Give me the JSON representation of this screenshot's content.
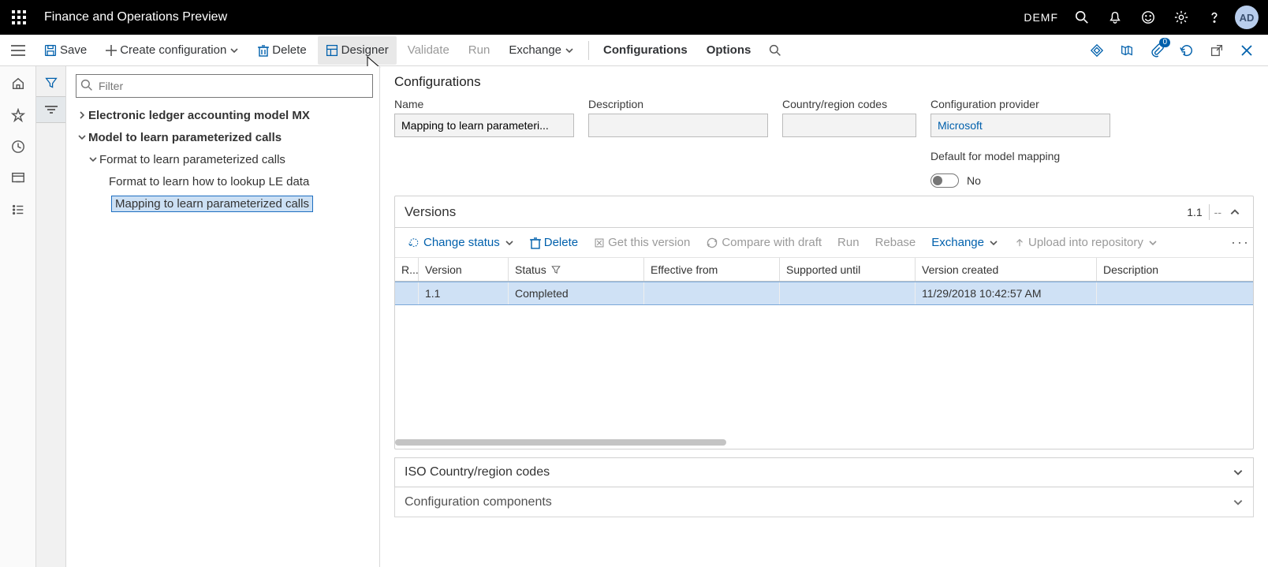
{
  "titlebar": {
    "app_title": "Finance and Operations Preview",
    "company": "DEMF",
    "avatar": "AD"
  },
  "actionbar": {
    "save": "Save",
    "create": "Create configuration",
    "delete": "Delete",
    "designer": "Designer",
    "validate": "Validate",
    "run": "Run",
    "exchange": "Exchange",
    "configurations": "Configurations",
    "options": "Options",
    "attach_count": "0"
  },
  "tree": {
    "filter_placeholder": "Filter",
    "items": {
      "root": "Electronic ledger accounting model MX",
      "model": "Model to learn parameterized calls",
      "format": "Format to learn parameterized calls",
      "format_le": "Format to learn how to lookup LE data",
      "mapping": "Mapping to learn parameterized calls"
    }
  },
  "details": {
    "section": "Configurations",
    "labels": {
      "name": "Name",
      "description": "Description",
      "country": "Country/region codes",
      "provider": "Configuration provider",
      "default_mapping": "Default for model mapping"
    },
    "values": {
      "name": "Mapping to learn parameteri...",
      "description": "",
      "country": "",
      "provider": "Microsoft",
      "default_mapping": "No"
    }
  },
  "versions": {
    "title": "Versions",
    "current": "1.1",
    "dash": "--",
    "toolbar": {
      "change_status": "Change status",
      "delete": "Delete",
      "get_version": "Get this version",
      "compare": "Compare with draft",
      "run": "Run",
      "rebase": "Rebase",
      "exchange": "Exchange",
      "upload": "Upload into repository"
    },
    "columns": {
      "r": "R...",
      "version": "Version",
      "status": "Status",
      "effective": "Effective from",
      "supported": "Supported until",
      "created": "Version created",
      "description": "Description"
    },
    "rows": [
      {
        "r": "",
        "version": "1.1",
        "status": "Completed",
        "effective": "",
        "supported": "",
        "created": "11/29/2018 10:42:57 AM",
        "description": ""
      }
    ]
  },
  "collapsibles": {
    "iso": "ISO Country/region codes",
    "components": "Configuration components"
  }
}
